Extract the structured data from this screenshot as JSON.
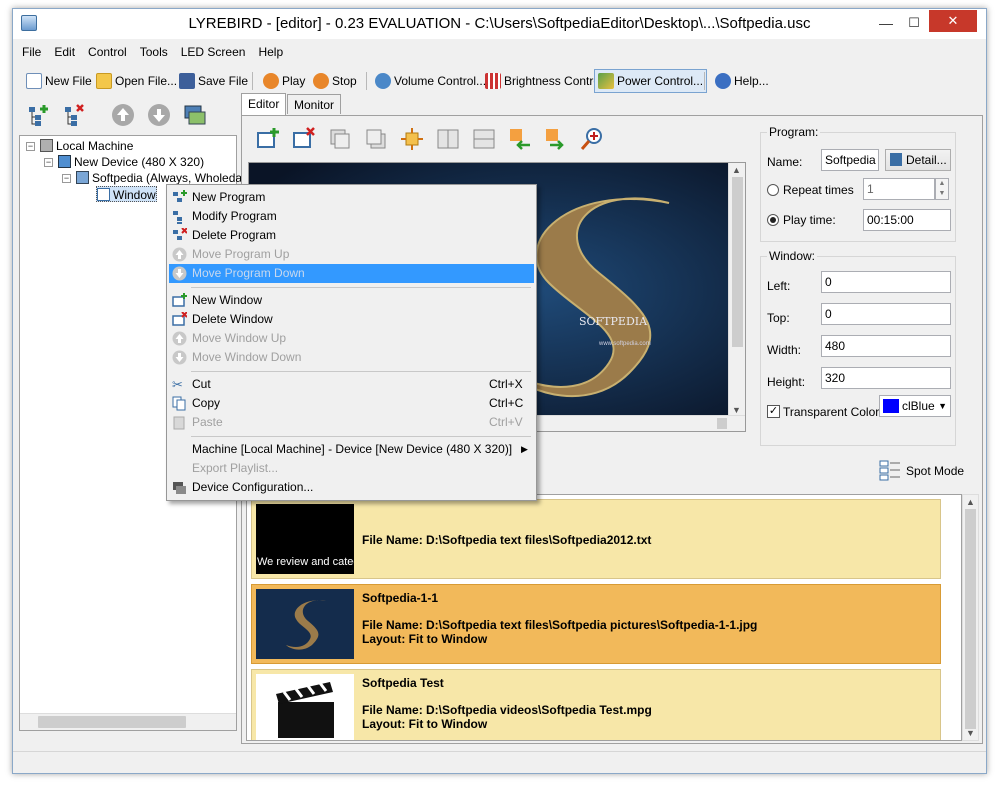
{
  "window": {
    "title": "LYREBIRD - [editor] - 0.23 EVALUATION - C:\\Users\\SoftpediaEditor\\Desktop\\...\\Softpedia.usc",
    "minimize_glyph": "—",
    "maximize_glyph": "☐",
    "close_glyph": "✕"
  },
  "menubar": [
    "File",
    "Edit",
    "Control",
    "Tools",
    "LED Screen",
    "Help"
  ],
  "toolbar": {
    "new_file": "New File",
    "open_file": "Open File...",
    "save_file": "Save File",
    "play": "Play",
    "stop": "Stop",
    "volume": "Volume Control...",
    "brightness": "Brightness Control",
    "power": "Power Control...",
    "help": "Help..."
  },
  "tree": {
    "nodes": [
      "Local Machine",
      "New Device (480 X 320)",
      "Softpedia (Always, Wholeda",
      "Window"
    ]
  },
  "tabs": [
    "Editor",
    "Monitor"
  ],
  "program": {
    "group_label": "Program:",
    "name_label": "Name:",
    "name_value": "Softpedia",
    "detail_button": "Detail...",
    "repeat_label": "Repeat times",
    "repeat_value": "1",
    "playtime_label": "Play time:",
    "playtime_value": "00:15:00"
  },
  "window_props": {
    "group_label": "Window:",
    "left_label": "Left:",
    "left_value": "0",
    "top_label": "Top:",
    "top_value": "0",
    "width_label": "Width:",
    "width_value": "480",
    "height_label": "Height:",
    "height_value": "320",
    "transparent_label": "Transparent Color:",
    "transparent_value": "clBlue"
  },
  "spot_mode": "Spot Mode",
  "preview": {
    "brand": "SOFTPEDIA",
    "url": "www.softpedia.com"
  },
  "playlist": [
    {
      "title": "",
      "file": "File Name: D:\\Softpedia text files\\Softpedia2012.txt",
      "layout": "",
      "thumb_text": "We review and categ",
      "selected": false
    },
    {
      "title": "Softpedia-1-1",
      "file": "File Name: D:\\Softpedia text files\\Softpedia pictures\\Softpedia-1-1.jpg",
      "layout": "Layout: Fit to Window",
      "thumb_text": "",
      "selected": true
    },
    {
      "title": "Softpedia Test",
      "file": "File Name: D:\\Softpedia videos\\Softpedia Test.mpg",
      "layout": "Layout: Fit to Window",
      "thumb_text": "",
      "selected": false
    }
  ],
  "context_menu": {
    "new_program": "New Program",
    "modify_program": "Modify Program",
    "delete_program": "Delete Program",
    "move_program_up": "Move Program Up",
    "move_program_down": "Move Program Down",
    "new_window": "New Window",
    "delete_window": "Delete Window",
    "move_window_up": "Move Window Up",
    "move_window_down": "Move Window Down",
    "cut": "Cut",
    "cut_sc": "Ctrl+X",
    "copy": "Copy",
    "copy_sc": "Ctrl+C",
    "paste": "Paste",
    "paste_sc": "Ctrl+V",
    "machine": "Machine [Local Machine] - Device [New Device (480 X 320)]",
    "export_playlist": "Export Playlist...",
    "device_config": "Device Configuration..."
  }
}
